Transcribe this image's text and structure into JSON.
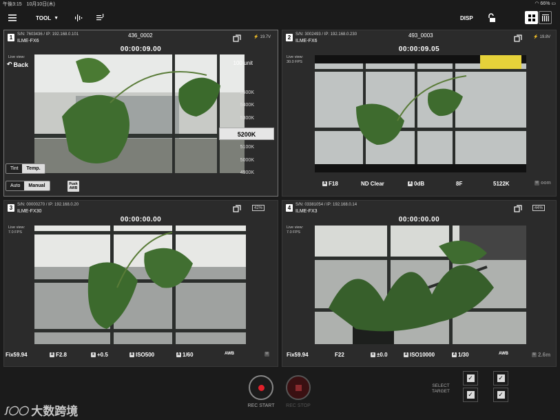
{
  "status": {
    "time_date": "午後3:15　10月10日(木)",
    "battery": "66%"
  },
  "toolbar": {
    "tool_label": "TOOL",
    "disp_label": "DISP"
  },
  "panels": [
    {
      "num": "1",
      "sn": "S/N: 7603436 / IP: 192.168.0.101",
      "model": "ILME-FX6",
      "clip": "436_0002",
      "timecode": "00:00:09.00",
      "voltage": "19.7V",
      "back_label": "Back",
      "live_view": "Live view:",
      "fps": ""
    },
    {
      "num": "2",
      "sn": "S/N: 3002493 / IP: 192.168.0.230",
      "model": "ILME-FX6",
      "clip": "493_0003",
      "timecode": "00:00:09.05",
      "voltage": "19.8V",
      "live_view": "Live view:",
      "fps": "30.0 FPS",
      "info": {
        "iris": "F18",
        "nd": "ND Clear",
        "gain": "0dB",
        "shutter": "8F",
        "wb": "5122K",
        "extra": "oom"
      }
    },
    {
      "num": "3",
      "sn": "S/N: 00000270 / IP: 192.168.0.20",
      "model": "ILME-FX30",
      "clip": "",
      "timecode": "00:00:00.00",
      "battery": "42%",
      "live_view": "Live view:",
      "fps": "7.0 FPS",
      "info": {
        "fps": "Fix59.94",
        "iris": "F2.8",
        "ev": "+0.5",
        "iso": "ISO500",
        "shutter": "1/60",
        "wb": "AWB"
      }
    },
    {
      "num": "4",
      "sn": "S/N: 03381054 / IP: 192.168.0.14",
      "model": "ILME-FX3",
      "clip": "",
      "timecode": "00:00:00.00",
      "battery": "44%",
      "live_view": "Live view:",
      "fps": "7.0 FPS",
      "info": {
        "fps": "Fix59.94",
        "iris": "F22",
        "ev": "±0.0",
        "iso": "ISO10000",
        "shutter": "1/30",
        "wb": "AWB",
        "focus": "2.6m"
      }
    }
  ],
  "wb_panel": {
    "unit": "100 unit",
    "values": [
      "5500K",
      "5400K",
      "5300K",
      "5200K",
      "5100K",
      "5000K",
      "4900K"
    ],
    "selected": "5200K",
    "tint_label": "Tint",
    "temp_label": "Temp.",
    "auto_label": "Auto",
    "manual_label": "Manual",
    "push_awb_label": "Push AWB"
  },
  "rec": {
    "start_label": "REC START",
    "stop_label": "REC STOP"
  },
  "select_target": {
    "label": "SELECT TARGET"
  },
  "watermark": "大数跨境",
  "icons": {
    "menu": "hamburger-icon",
    "waveform": "waveform-icon",
    "list": "list-icon",
    "lock": "unlock-icon",
    "grid": "grid-icon",
    "bars": "bars-icon"
  }
}
